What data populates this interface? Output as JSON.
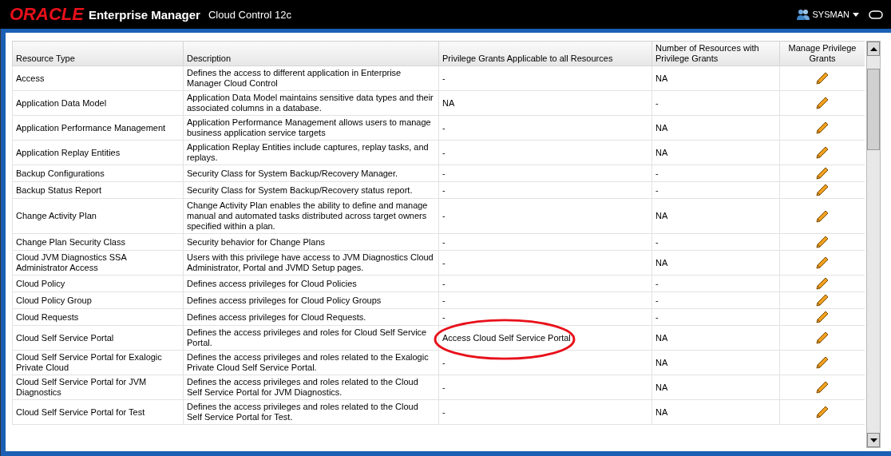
{
  "header": {
    "logo": "ORACLE",
    "product": "Enterprise Manager",
    "subtitle": "Cloud Control 12c",
    "user": "SYSMAN"
  },
  "table": {
    "columns": [
      "Resource Type",
      "Description",
      "Privilege Grants Applicable to all Resources",
      "Number of Resources with Privilege Grants",
      "Manage Privilege Grants"
    ],
    "rows": [
      {
        "type": "Access",
        "description": "Defines the access to different application in Enterprise Manager Cloud Control",
        "grants": "-",
        "count": "NA",
        "highlighted": false
      },
      {
        "type": "Application Data Model",
        "description": "Application Data Model maintains sensitive data types and their associated columns in a database.",
        "grants": "NA",
        "count": "-",
        "highlighted": false
      },
      {
        "type": "Application Performance Management",
        "description": "Application Performance Management allows users to manage business application service targets",
        "grants": "-",
        "count": "NA",
        "highlighted": false
      },
      {
        "type": "Application Replay Entities",
        "description": "Application Replay Entities include captures, replay tasks, and replays.",
        "grants": "-",
        "count": "NA",
        "highlighted": false
      },
      {
        "type": "Backup Configurations",
        "description": "Security Class for System Backup/Recovery Manager.",
        "grants": "-",
        "count": "-",
        "highlighted": false
      },
      {
        "type": "Backup Status Report",
        "description": "Security Class for System Backup/Recovery status report.",
        "grants": "-",
        "count": "-",
        "highlighted": false
      },
      {
        "type": "Change Activity Plan",
        "description": "Change Activity Plan enables the ability to define and manage manual and automated tasks distributed across target owners specified within a plan.",
        "grants": "-",
        "count": "NA",
        "highlighted": false
      },
      {
        "type": "Change Plan Security Class",
        "description": "Security behavior for Change Plans",
        "grants": "-",
        "count": "-",
        "highlighted": false
      },
      {
        "type": "Cloud JVM Diagnostics SSA Administrator Access",
        "description": "Users with this privilege have access to JVM Diagnostics Cloud Administrator, Portal and JVMD Setup pages.",
        "grants": "-",
        "count": "NA",
        "highlighted": false
      },
      {
        "type": "Cloud Policy",
        "description": "Defines access privileges for Cloud Policies",
        "grants": "-",
        "count": "-",
        "highlighted": false
      },
      {
        "type": "Cloud Policy Group",
        "description": "Defines access privileges for Cloud Policy Groups",
        "grants": "-",
        "count": "-",
        "highlighted": false
      },
      {
        "type": "Cloud Requests",
        "description": "Defines access privileges for Cloud Requests.",
        "grants": "-",
        "count": "-",
        "highlighted": false
      },
      {
        "type": "Cloud Self Service Portal",
        "description": "Defines the access privileges and roles for Cloud Self Service Portal.",
        "grants": "Access Cloud Self Service Portal",
        "count": "NA",
        "highlighted": true
      },
      {
        "type": "Cloud Self Service Portal for Exalogic Private Cloud",
        "description": "Defines the access privileges and roles related to the Exalogic Private Cloud Self Service Portal.",
        "grants": "-",
        "count": "NA",
        "highlighted": false
      },
      {
        "type": "Cloud Self Service Portal for JVM Diagnostics",
        "description": "Defines the access privileges and roles related to the Cloud Self Service Portal for JVM Diagnostics.",
        "grants": "-",
        "count": "NA",
        "highlighted": false
      },
      {
        "type": "Cloud Self Service Portal for Test",
        "description": "Defines the access privileges and roles related to the Cloud Self Service Portal for Test.",
        "grants": "-",
        "count": "NA",
        "highlighted": false
      }
    ]
  }
}
